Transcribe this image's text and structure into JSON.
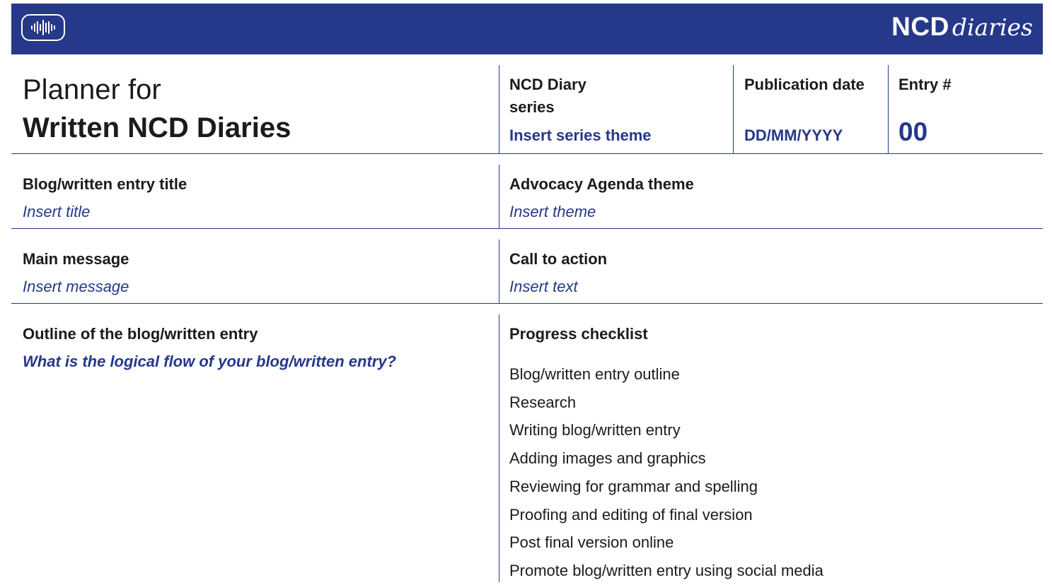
{
  "header": {
    "brand_bold": "NCD",
    "brand_script": "diaries",
    "icon": "soundwave-icon"
  },
  "planner": {
    "title_line1": "Planner for",
    "title_line2": "Written NCD Diaries"
  },
  "series": {
    "label": "NCD Diary series",
    "value": "Insert series theme"
  },
  "publication": {
    "label": "Publication date",
    "value": "DD/MM/YYYY"
  },
  "entry": {
    "label": "Entry #",
    "value": "00"
  },
  "blog_title": {
    "label": "Blog/written entry title",
    "placeholder": "Insert title"
  },
  "advocacy": {
    "label": "Advocacy Agenda theme",
    "placeholder": "Insert theme"
  },
  "main_message": {
    "label": "Main message",
    "placeholder": "Insert message"
  },
  "call_to_action": {
    "label": "Call to action",
    "placeholder": "Insert text"
  },
  "outline": {
    "label": "Outline of the blog/written entry",
    "prompt": "What is the logical flow of your blog/written entry?"
  },
  "checklist": {
    "label": "Progress checklist",
    "items": [
      "Blog/written entry outline",
      "Research",
      "Writing blog/written entry",
      "Adding images and graphics",
      "Reviewing for grammar and spelling",
      "Proofing and editing of final version",
      "Post final version online",
      "Promote blog/written entry using social media"
    ]
  },
  "colors": {
    "brand": "#26388a",
    "text": "#1b1b1b",
    "background": "#ffffff"
  }
}
